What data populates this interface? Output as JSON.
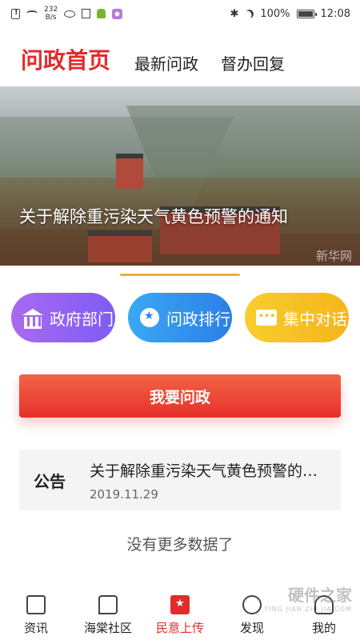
{
  "status_bar": {
    "net_speed_value": "232",
    "net_speed_unit": "B/s",
    "battery_level": "100%",
    "battery_fill": 1.0,
    "time": "12:08"
  },
  "tabs": [
    {
      "label": "问政首页",
      "active": true
    },
    {
      "label": "最新问政",
      "active": false
    },
    {
      "label": "督办回复",
      "active": false
    }
  ],
  "banner": {
    "caption": "关于解除重污染天气黄色预警的通知",
    "watermark": "新华网"
  },
  "shortcuts": [
    {
      "label": "政府部门",
      "icon": "building-icon"
    },
    {
      "label": "问政排行",
      "icon": "medal-icon"
    },
    {
      "label": "集中对话",
      "icon": "chat-icon"
    }
  ],
  "ask_button": "我要问政",
  "notice": {
    "tag": "公告",
    "title": "关于解除重污染天气黄色预警的通知",
    "date": "2019.11.29"
  },
  "empty_text": "没有更多数据了",
  "bottom_nav": [
    {
      "label": "资讯",
      "icon": "document-icon",
      "active": false
    },
    {
      "label": "海棠社区",
      "icon": "chat-bubble-icon",
      "active": false
    },
    {
      "label": "民意上传",
      "icon": "star-badge-icon",
      "active": true
    },
    {
      "label": "发现",
      "icon": "search-icon",
      "active": false
    },
    {
      "label": "我的",
      "icon": "user-icon",
      "active": false
    }
  ],
  "site_watermark": {
    "title": "硬件之家",
    "subtitle": "YING JIAN ZHI JIA.COM"
  }
}
